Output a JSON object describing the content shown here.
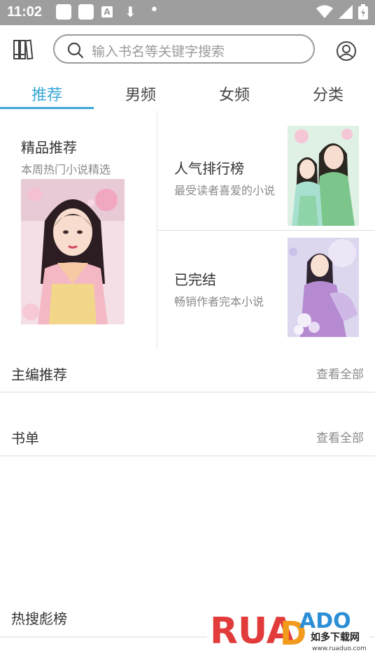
{
  "status_bar": {
    "time": "11:02"
  },
  "search": {
    "placeholder": "输入书名等关键字搜索"
  },
  "tabs": [
    {
      "label": "推荐",
      "active": true
    },
    {
      "label": "男频",
      "active": false
    },
    {
      "label": "女频",
      "active": false
    },
    {
      "label": "分类",
      "active": false
    }
  ],
  "features": {
    "left": {
      "title": "精品推荐",
      "subtitle": "本周热门小说精选"
    },
    "top_right": {
      "title": "人气排行榜",
      "subtitle": "最受读者喜爱的小说"
    },
    "bottom_right": {
      "title": "已完结",
      "subtitle": "畅销作者完本小说"
    }
  },
  "sections": [
    {
      "label": "主编推荐",
      "more": "查看全部"
    },
    {
      "label": "书单",
      "more": "查看全部"
    },
    {
      "label": "热搜彪榜"
    }
  ],
  "watermark": {
    "brand": "RUANDADO",
    "cn": "如多下载网",
    "url": "www.ruaduo.com"
  },
  "colors": {
    "accent": "#3aa7d6",
    "status_bar": "#9e9e9e"
  }
}
